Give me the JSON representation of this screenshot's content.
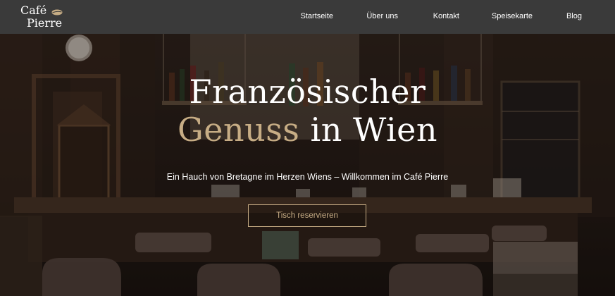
{
  "nav": {
    "logo_line1": "Café",
    "logo_line2": "Pierre",
    "items": [
      {
        "label": "Startseite"
      },
      {
        "label": "Über uns"
      },
      {
        "label": "Kontakt"
      },
      {
        "label": "Speisekarte"
      },
      {
        "label": "Blog"
      }
    ]
  },
  "hero": {
    "title_line1": "Französischer",
    "title_accent": "Genuss",
    "title_rest": " in Wien",
    "subtitle": "Ein Hauch von Bretagne im Herzen Wiens – Willkommen im Café Pierre",
    "cta_label": "Tisch reservieren"
  },
  "colors": {
    "nav_bg": "#3a3a3a",
    "accent": "#c7ad85",
    "text": "#ffffff"
  }
}
